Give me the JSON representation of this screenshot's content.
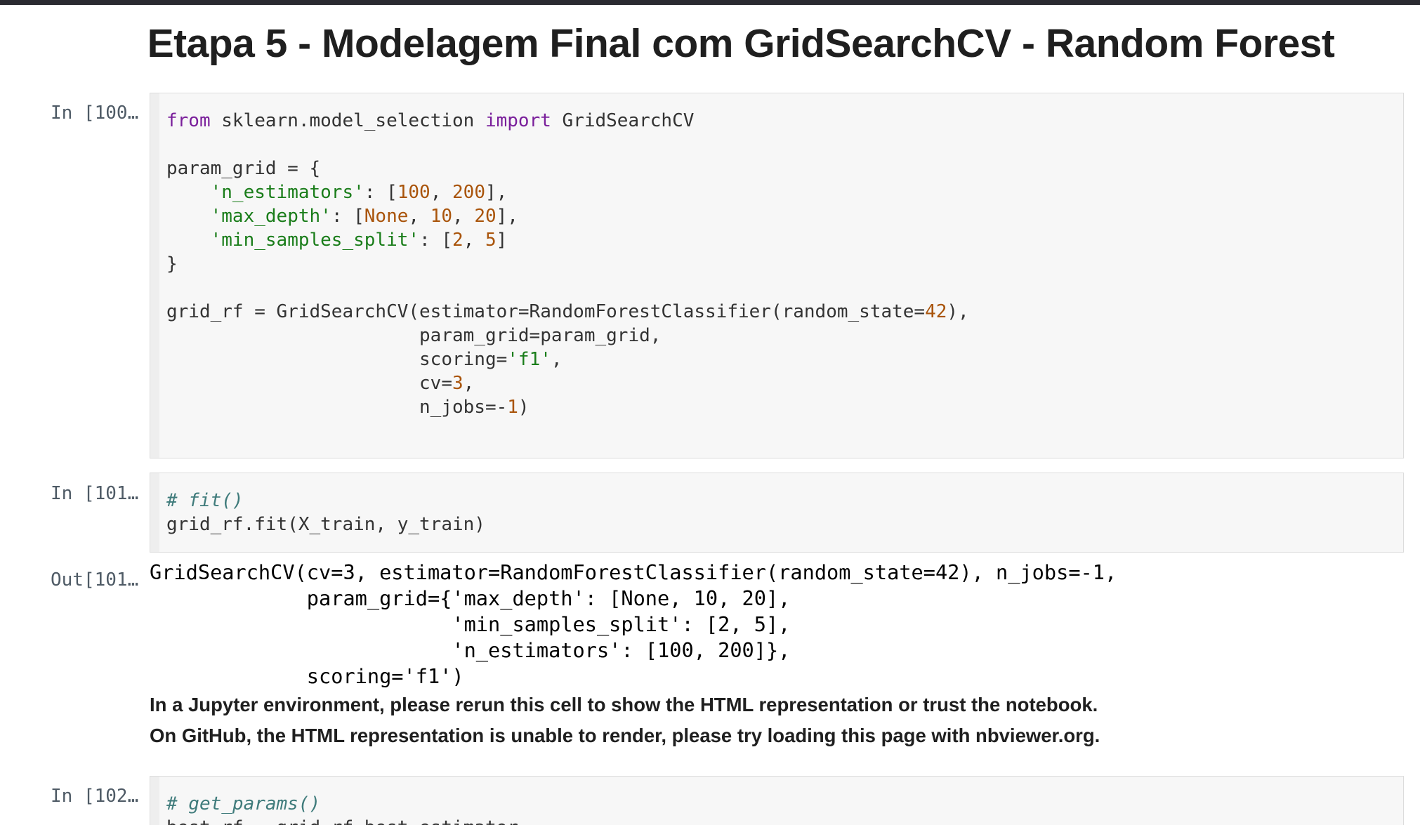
{
  "notebook": {
    "title": "Etapa 5 - Modelagem Final com GridSearchCV - Random Forest",
    "colors": {
      "keyword": "#7a1f9b",
      "string": "#1a7d1a",
      "number": "#a9540b",
      "comment": "#3f7b7b",
      "prompt": "#4f5b66",
      "cell_background": "#f7f7f7"
    }
  },
  "cells": [
    {
      "prompt": "In [100…",
      "lines": [
        [
          {
            "t": "from",
            "c": "kw"
          },
          {
            "t": " sklearn.model_selection "
          },
          {
            "t": "import",
            "c": "kw"
          },
          {
            "t": " GridSearchCV"
          }
        ],
        [],
        [
          {
            "t": "param_grid = {"
          }
        ],
        [
          {
            "t": "    "
          },
          {
            "t": "'n_estimators'",
            "c": "st"
          },
          {
            "t": ": ["
          },
          {
            "t": "100",
            "c": "nu"
          },
          {
            "t": ", "
          },
          {
            "t": "200",
            "c": "nu"
          },
          {
            "t": "],"
          }
        ],
        [
          {
            "t": "    "
          },
          {
            "t": "'max_depth'",
            "c": "st"
          },
          {
            "t": ": ["
          },
          {
            "t": "None",
            "c": "bi"
          },
          {
            "t": ", "
          },
          {
            "t": "10",
            "c": "nu"
          },
          {
            "t": ", "
          },
          {
            "t": "20",
            "c": "nu"
          },
          {
            "t": "],"
          }
        ],
        [
          {
            "t": "    "
          },
          {
            "t": "'min_samples_split'",
            "c": "st"
          },
          {
            "t": ": ["
          },
          {
            "t": "2",
            "c": "nu"
          },
          {
            "t": ", "
          },
          {
            "t": "5",
            "c": "nu"
          },
          {
            "t": "]"
          }
        ],
        [
          {
            "t": "}"
          }
        ],
        [],
        [
          {
            "t": "grid_rf = GridSearchCV(estimator=RandomForestClassifier(random_state="
          },
          {
            "t": "42",
            "c": "nu"
          },
          {
            "t": "),"
          }
        ],
        [
          {
            "t": "                       param_grid=param_grid,"
          }
        ],
        [
          {
            "t": "                       scoring="
          },
          {
            "t": "'f1'",
            "c": "st"
          },
          {
            "t": ","
          }
        ],
        [
          {
            "t": "                       cv="
          },
          {
            "t": "3",
            "c": "nu"
          },
          {
            "t": ","
          }
        ],
        [
          {
            "t": "                       n_jobs=-"
          },
          {
            "t": "1",
            "c": "nu"
          },
          {
            "t": ")"
          }
        ]
      ]
    },
    {
      "prompt": "In [101…",
      "lines": [
        [
          {
            "t": "# fit()",
            "c": "cm"
          }
        ],
        [
          {
            "t": "grid_rf.fit(X_train, y_train)"
          }
        ]
      ]
    },
    {
      "prompt": "In [102…",
      "lines": [
        [
          {
            "t": "# get_params()",
            "c": "cm"
          }
        ],
        [
          {
            "t": "best_rf = grid_rf.best_estimator_"
          }
        ]
      ]
    }
  ],
  "output": {
    "prompt": "Out[101…",
    "text": "GridSearchCV(cv=3, estimator=RandomForestClassifier(random_state=42), n_jobs=-1,\n             param_grid={'max_depth': [None, 10, 20],\n                         'min_samples_split': [2, 5],\n                         'n_estimators': [100, 200]},\n             scoring='f1')",
    "warning_line1": "In a Jupyter environment, please rerun this cell to show the HTML representation or trust the notebook.",
    "warning_line2": "On GitHub, the HTML representation is unable to render, please try loading this page with nbviewer.org."
  }
}
